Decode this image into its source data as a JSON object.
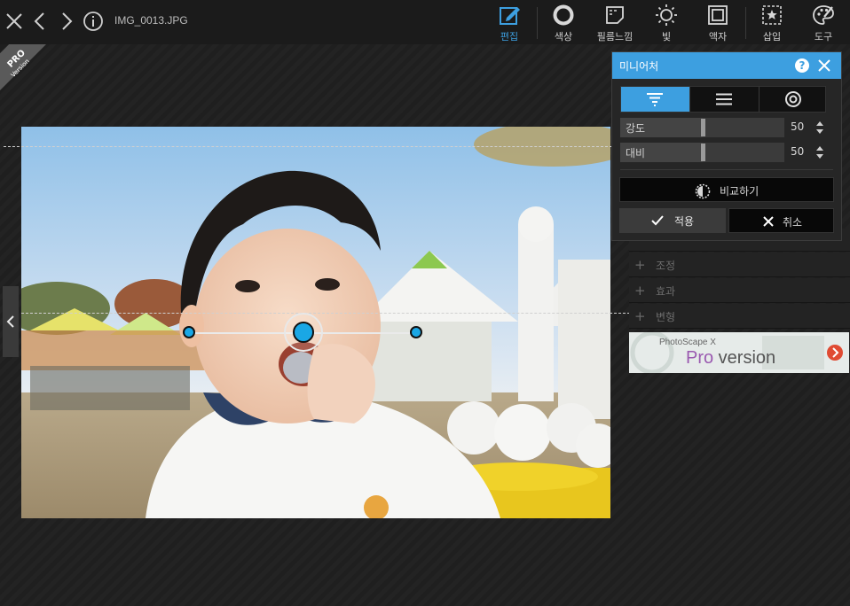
{
  "header": {
    "filename": "IMG_0013.JPG"
  },
  "toolbar": {
    "tools": [
      {
        "label": "편집",
        "icon": "edit-icon",
        "active": true
      },
      {
        "label": "색상",
        "icon": "color-circle-icon"
      },
      {
        "label": "필름느낌",
        "icon": "film-icon"
      },
      {
        "label": "빛",
        "icon": "light-sun-icon"
      },
      {
        "label": "액자",
        "icon": "frame-icon"
      },
      {
        "label": "삽입",
        "icon": "insert-star-icon"
      },
      {
        "label": "도구",
        "icon": "palette-tools-icon"
      }
    ]
  },
  "pro_badge": {
    "line1": "PRO",
    "line2": "Version"
  },
  "side_panel": {
    "rows": [
      {
        "label": "조정"
      },
      {
        "label": "효과"
      },
      {
        "label": "변형"
      }
    ],
    "banner": {
      "small": "PhotoScape X",
      "pro": "Pro",
      "version": " version"
    }
  },
  "dialog": {
    "title": "미니어처",
    "help": "?",
    "modes": [
      "linear-icon",
      "horizontal-lines-icon",
      "radial-icon"
    ],
    "sliders": [
      {
        "label": "강도",
        "value": "50",
        "fraction": 0.5
      },
      {
        "label": "대비",
        "value": "50",
        "fraction": 0.5
      }
    ],
    "compare_label": "비교하기",
    "apply_label": "적용",
    "cancel_label": "취소"
  },
  "colors": {
    "accent": "#3d9fe0",
    "handle": "#1aa7e5",
    "toolbar_bg": "#1b1b1b"
  }
}
